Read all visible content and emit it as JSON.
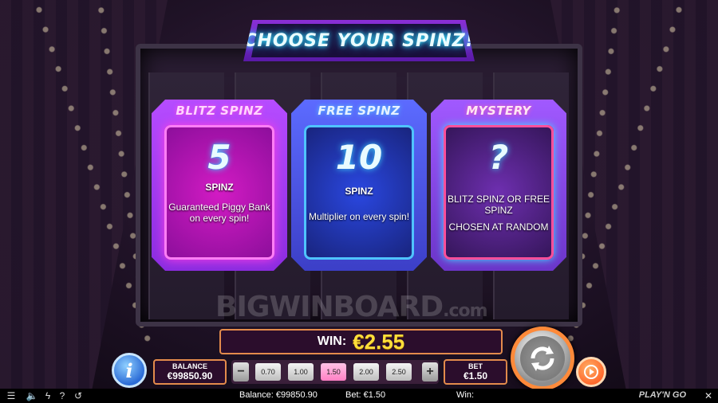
{
  "banner": {
    "title": "CHOOSE YOUR SPINZ!"
  },
  "cards": [
    {
      "title": "BLITZ SPINZ",
      "number": "5",
      "unit": "SPINZ",
      "description": "Guaranteed Piggy Bank on every spin!"
    },
    {
      "title": "FREE SPINZ",
      "number": "10",
      "unit": "SPINZ",
      "description": "Multiplier on every spin!"
    },
    {
      "title": "MYSTERY",
      "number": "?",
      "line1": "BLITZ SPINZ OR FREE SPINZ",
      "line2": "CHOSEN AT RANDOM"
    }
  ],
  "watermark": {
    "text": "BIGWINBOARD",
    "suffix": ".com"
  },
  "win": {
    "label": "WIN:",
    "value": "€2.55"
  },
  "balance": {
    "caption": "BALANCE",
    "value": "€99850.90"
  },
  "bet": {
    "caption": "BET",
    "value": "€1.50",
    "options": [
      "0.70",
      "1.00",
      "1.50",
      "2.00",
      "2.50"
    ],
    "selected": "1.50"
  },
  "buttons": {
    "info": "i",
    "minus": "−",
    "plus": "+"
  },
  "status": {
    "balance": "Balance: €99850.90",
    "bet": "Bet: €1.50",
    "win": "Win:",
    "brand": "PLAY'N GO",
    "close": "✕"
  },
  "colors": {
    "accent": "#e38b4c",
    "win_value": "#ffde3a",
    "blitz": "#ff4de1",
    "free": "#4d7bff",
    "mystery": "#ff4f9b"
  }
}
